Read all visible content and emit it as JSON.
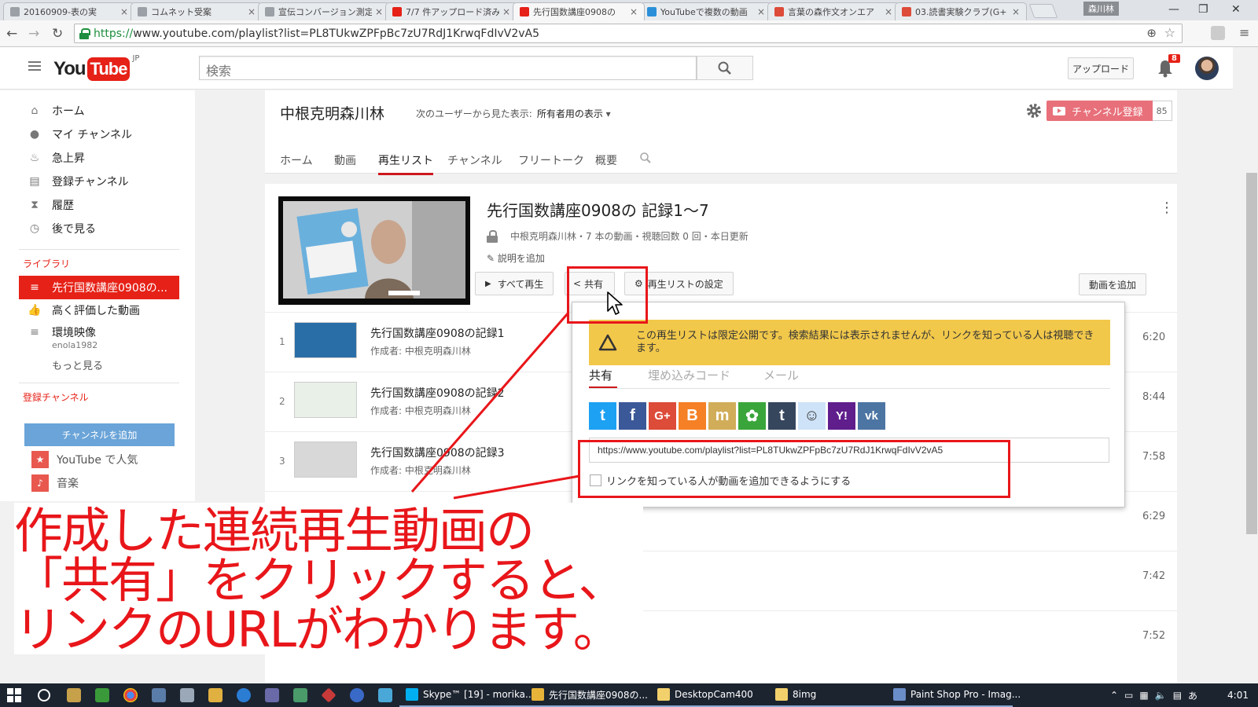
{
  "browser": {
    "tabs": [
      {
        "title": "20160909-表の実",
        "icon": "doc-icon",
        "color": "#9aa0a6"
      },
      {
        "title": "コムネット受案",
        "icon": "doc-icon",
        "color": "#9aa0a6"
      },
      {
        "title": "宣伝コンバージョン測定",
        "icon": "doc-icon",
        "color": "#9aa0a6"
      },
      {
        "title": "7/7 件アップロード済み",
        "icon": "youtube-icon",
        "color": "#e62117"
      },
      {
        "title": "先行国数講座0908の",
        "icon": "youtube-icon",
        "color": "#e62117",
        "active": true
      },
      {
        "title": "YouTubeで複数の動画",
        "icon": "de-icon",
        "color": "#2a8fd8"
      },
      {
        "title": "言葉の森作文オンエア",
        "icon": "google-plus-icon",
        "color": "#dd4b39"
      },
      {
        "title": "03.読書実験クラブ(G+",
        "icon": "google-plus-icon",
        "color": "#dd4b39"
      }
    ],
    "user_label": "森川林",
    "url_protocol": "https://",
    "url_rest": "www.youtube.com/playlist?list=PL8TUkwZPFpBc7zU7RdJ1KrwqFdIvV2vA5"
  },
  "header": {
    "logo_you": "You",
    "logo_tube": "Tube",
    "logo_region": "JP",
    "search_placeholder": "検索",
    "upload_label": "アップロード",
    "notification_count": "8"
  },
  "sidebar": {
    "items": [
      {
        "label": "ホーム",
        "icon": "home-icon"
      },
      {
        "label": "マイ チャンネル",
        "icon": "person-icon"
      },
      {
        "label": "急上昇",
        "icon": "flame-icon"
      },
      {
        "label": "登録チャンネル",
        "icon": "subscriptions-icon"
      },
      {
        "label": "履歴",
        "icon": "hourglass-icon"
      },
      {
        "label": "後で見る",
        "icon": "clock-icon"
      }
    ],
    "library_heading": "ライブラリ",
    "library": [
      {
        "label": "先行国数講座0908の...",
        "icon": "list-icon",
        "active": true
      },
      {
        "label": "高く評価した動画",
        "icon": "thumbs-up-icon"
      },
      {
        "label": "環境映像",
        "sub": "enola1982",
        "icon": "list-icon"
      }
    ],
    "more_label": "もっと見る",
    "subscriptions_heading": "登録チャンネル",
    "add_channel_label": "チャンネルを追加",
    "subscriptions": [
      {
        "label": "YouTube で人気",
        "icon": "star-icon"
      },
      {
        "label": "音楽",
        "icon": "music-icon"
      }
    ]
  },
  "channel": {
    "name": "中根克明森川林",
    "view_as_label": "次のユーザーから見た表示:",
    "view_as_value": "所有者用の表示",
    "subscribe_label": "チャンネル登録",
    "subscriber_count": "85",
    "tabs": [
      "ホーム",
      "動画",
      "再生リスト",
      "チャンネル",
      "フリートーク",
      "概要"
    ],
    "active_tab": "再生リスト"
  },
  "playlist": {
    "title": "先行国数講座0908の 記録1〜7",
    "meta": "中根克明森川林・7 本の動画・視聴回数 0 回・本日更新",
    "add_description": "説明を追加",
    "play_all_label": "すべて再生",
    "share_label": "共有",
    "settings_label": "再生リストの設定",
    "add_video_label": "動画を追加",
    "videos": [
      {
        "index": "1",
        "title": "先行国数講座0908の記録1",
        "owner": "作成者: 中根克明森川林",
        "duration": "6:20"
      },
      {
        "index": "2",
        "title": "先行国数講座0908の記録2",
        "owner": "作成者: 中根克明森川林",
        "duration": "8:44"
      },
      {
        "index": "3",
        "title": "先行国数講座0908の記録3",
        "owner": "作成者: 中根克明森川林",
        "duration": "7:58"
      },
      {
        "index": "",
        "title": "",
        "owner": "",
        "duration": "6:29"
      },
      {
        "index": "",
        "title": "",
        "owner": "",
        "duration": "7:42"
      },
      {
        "index": "",
        "title": "",
        "owner": "",
        "duration": "7:52"
      }
    ]
  },
  "share_popup": {
    "warning": "この再生リストは限定公開です。検索結果には表示されませんが、リンクを知っている人は視聴できます。",
    "tabs": [
      "共有",
      "埋め込みコード",
      "メール"
    ],
    "social": [
      {
        "name": "twitter-icon",
        "glyph": "t",
        "color": "#1da1f2"
      },
      {
        "name": "facebook-icon",
        "glyph": "f",
        "color": "#3b5998"
      },
      {
        "name": "google-plus-icon",
        "glyph": "G+",
        "color": "#dd4b39"
      },
      {
        "name": "blogger-icon",
        "glyph": "B",
        "color": "#f58025"
      },
      {
        "name": "mixi-icon",
        "glyph": "m",
        "color": "#d1ad59"
      },
      {
        "name": "goo-icon",
        "glyph": "✿",
        "color": "#3aa53a"
      },
      {
        "name": "tumblr-icon",
        "glyph": "t",
        "color": "#36465d"
      },
      {
        "name": "reddit-icon",
        "glyph": "☺",
        "color": "#cee3f8"
      },
      {
        "name": "yahoo-icon",
        "glyph": "Y!",
        "color": "#5f1e8c"
      },
      {
        "name": "vk-icon",
        "glyph": "vk",
        "color": "#4c75a3"
      }
    ],
    "link_url": "https://www.youtube.com/playlist?list=PL8TUkwZPFpBc7zU7RdJ1KrwqFdIvV2vA5",
    "allow_add_label": "リンクを知っている人が動画を追加できるようにする"
  },
  "annotation": {
    "lines": [
      "作成した連続再生動画の",
      "「共有」をクリックすると、",
      "リンクのURLがわかります。"
    ],
    "color": "#e8161a"
  },
  "taskbar": {
    "tasks": [
      {
        "label": "Skype™ [19] - morika...",
        "color": "#00aff0"
      },
      {
        "label": "先行国数講座0908の...",
        "color": "#e8b339"
      },
      {
        "label": "DesktopCam400",
        "color": "#f2d06b"
      },
      {
        "label": "8img",
        "color": "#f2d06b"
      },
      {
        "label": "Paint Shop Pro - Imag...",
        "color": "#6a8ec8"
      }
    ],
    "ime": "あ",
    "clock": "4:01"
  }
}
